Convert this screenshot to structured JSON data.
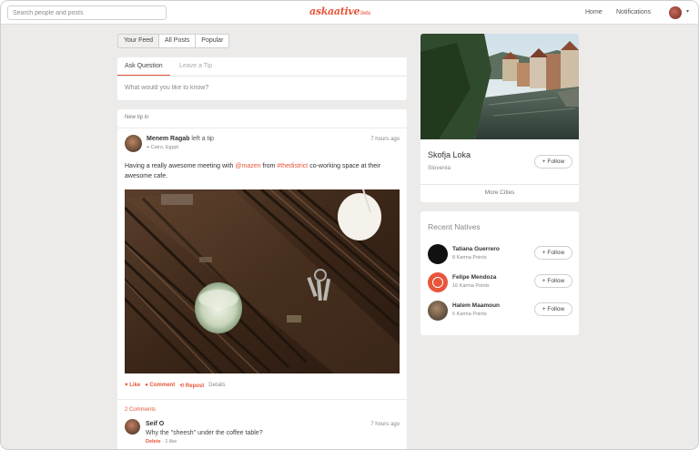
{
  "header": {
    "search_placeholder": "Search people and posts",
    "logo": "askaative",
    "logo_beta": "beta",
    "nav": [
      "Home",
      "Notifications"
    ]
  },
  "feed_tabs": [
    "Your Feed",
    "All Posts",
    "Popular"
  ],
  "ask": {
    "tabs": [
      "Ask Question",
      "Leave a Tip"
    ],
    "placeholder": "What would you like to know?"
  },
  "post": {
    "label": "New tip in",
    "author": "Menem Ragab",
    "action": "left a tip",
    "location": "Cairo, Egypt",
    "time": "7 hours ago",
    "text_before": "Having a really awesome meeting with ",
    "mention1": "@mazen",
    "text_mid": " from ",
    "mention2": "#thedistrict",
    "text_after": " co-working space at their awesome cafe.",
    "actions": {
      "like": "Like",
      "comment": "Comment",
      "repost": "Repost",
      "details": "Details"
    },
    "comments_count": "2 Comments"
  },
  "comment": {
    "author": "Seif O",
    "time": "7 hours ago",
    "text": "Why the \"sheesh\" under the coffee table?",
    "delete": "Delete",
    "likes": "· 1 like"
  },
  "city": {
    "name": "Skofja Loka",
    "country": "Slovenia",
    "follow": "Follow",
    "more": "More Cities"
  },
  "natives": {
    "title": "Recent Natives",
    "people": [
      {
        "name": "Tatiana Guerrero",
        "karma": "8 Karma Points",
        "follow": "Follow"
      },
      {
        "name": "Felipe Mendoza",
        "karma": "16 Karma Points",
        "follow": "Follow"
      },
      {
        "name": "Hatem Maamoun",
        "karma": "5 Karma Points",
        "follow": "Follow"
      }
    ]
  },
  "colors": {
    "accent": "#e8553a",
    "background": "#ecebea"
  },
  "icons": {
    "follow_plus": "+",
    "location": "📍",
    "like": "heart-icon",
    "comment": "speech-bubble-icon",
    "repost": "repost-icon"
  }
}
